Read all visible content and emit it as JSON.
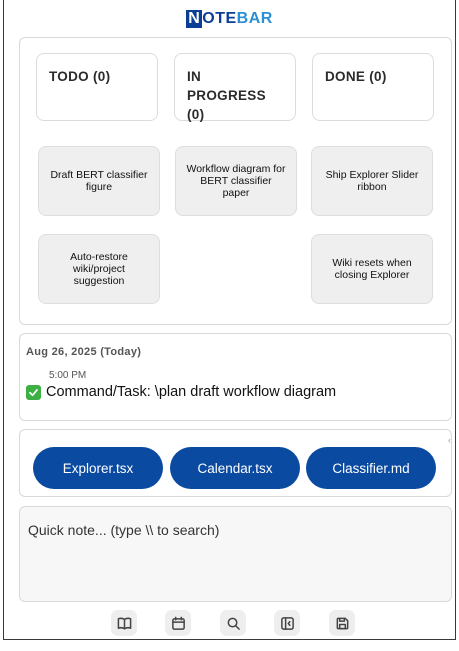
{
  "app": {
    "logo_first_letter": "N",
    "logo_middle": "OTE",
    "logo_last": "BAR",
    "brand_color": "#0a3f95",
    "brand_accent_color": "#2a8fd6"
  },
  "board": {
    "columns": [
      {
        "label": "TODO (0)"
      },
      {
        "label": "IN PROGRESS (0)"
      },
      {
        "label": "DONE (0)"
      }
    ],
    "cards": [
      {
        "label": "Draft BERT classifier figure"
      },
      {
        "label": "Workflow diagram for BERT classifier paper"
      },
      {
        "label": "Ship Explorer Slider ribbon"
      },
      {
        "label": "Auto-restore wiki/project suggestion"
      },
      {
        "label": "Wiki resets when closing Explorer"
      }
    ],
    "card_color": "#efefef"
  },
  "log": {
    "date": "Aug 26, 2025 (Today)",
    "time": "5:00 PM",
    "entry": "Command/Task: \\plan draft workflow diagram",
    "check_icon": "check-mark-icon",
    "check_color": "#3cb043"
  },
  "files": {
    "items": [
      {
        "label": "Explorer.tsx"
      },
      {
        "label": "Calendar.tsx"
      },
      {
        "label": "Classifier.md"
      }
    ],
    "scroll_hint": "‹",
    "button_color": "#0a4aa0"
  },
  "note": {
    "placeholder": "Quick note... (type \\\\ to search)",
    "value": ""
  },
  "toolbar": {
    "icons": [
      "book-icon",
      "calendar-icon",
      "search-icon",
      "sidebar-collapse-icon",
      "save-icon"
    ]
  }
}
